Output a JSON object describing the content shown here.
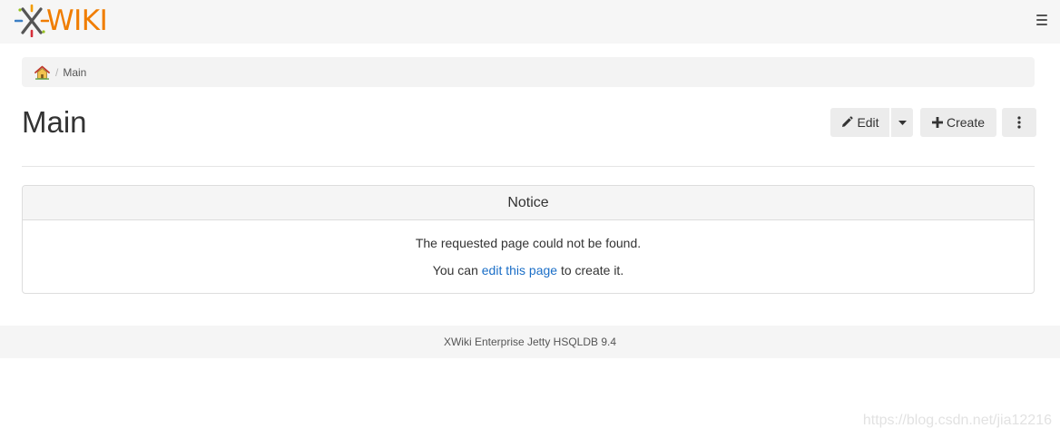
{
  "app": {
    "logo_text": "WIKI",
    "brand_color": "#f07d00"
  },
  "header": {
    "menu_icon": "hamburger-icon"
  },
  "breadcrumb": {
    "home_icon": "home-icon",
    "separator": "/",
    "current": "Main"
  },
  "page": {
    "title": "Main"
  },
  "toolbar": {
    "edit_label": "Edit",
    "create_label": "Create",
    "more_icon": "vertical-ellipsis-icon"
  },
  "notice": {
    "title": "Notice",
    "message": "The requested page could not be found.",
    "hint_prefix": "You can ",
    "hint_link": "edit this page",
    "hint_suffix": " to create it.",
    "link_color": "#1a6ec7"
  },
  "footer": {
    "text": "XWiki Enterprise Jetty HSQLDB 9.4"
  },
  "watermark": {
    "text": "https://blog.csdn.net/jia12216"
  }
}
